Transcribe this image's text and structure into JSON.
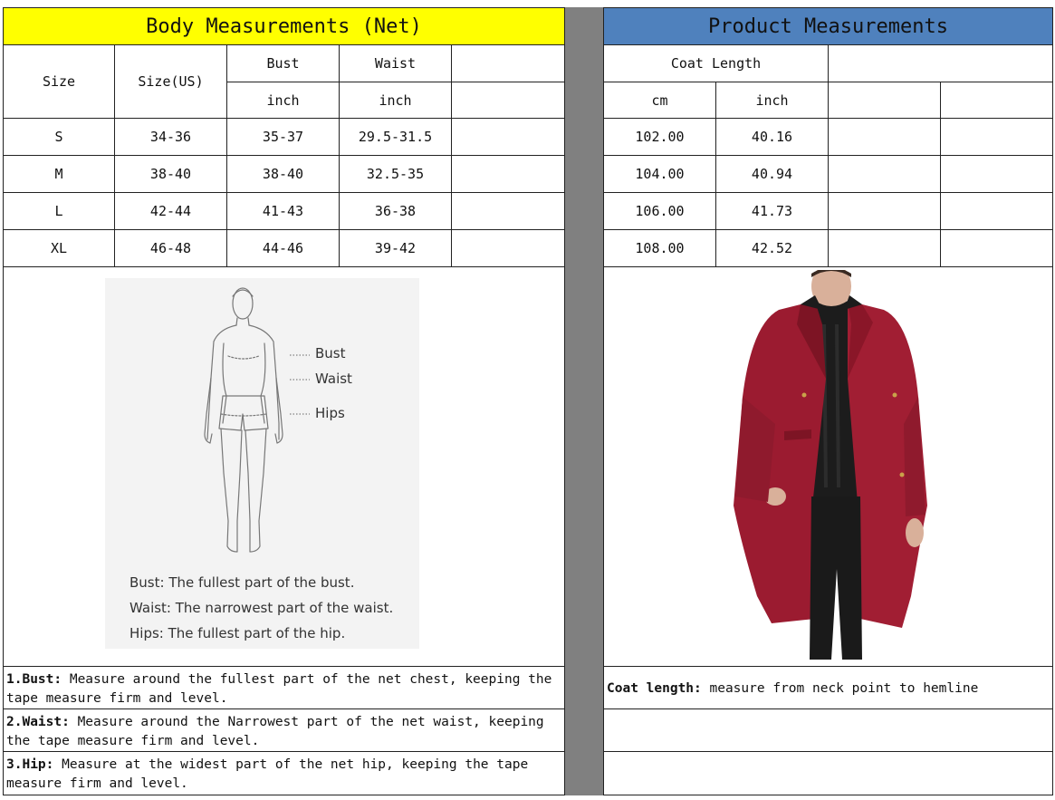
{
  "left_table": {
    "title": "Body Measurements  (Net)",
    "headers": {
      "size": "Size",
      "size_us": "Size(US)",
      "bust": "Bust",
      "waist": "Waist",
      "bust_unit": "inch",
      "waist_unit": "inch"
    },
    "rows": [
      {
        "size": "S",
        "size_us": "34-36",
        "bust": "35-37",
        "waist": "29.5-31.5"
      },
      {
        "size": "M",
        "size_us": "38-40",
        "bust": "38-40",
        "waist": "32.5-35"
      },
      {
        "size": "L",
        "size_us": "42-44",
        "bust": "41-43",
        "waist": "36-38"
      },
      {
        "size": "XL",
        "size_us": "46-48",
        "bust": "44-46",
        "waist": "39-42"
      }
    ]
  },
  "right_table": {
    "title": "Product Measurements",
    "headers": {
      "coat_length": "Coat Length",
      "cm": "cm",
      "inch": "inch"
    },
    "rows": [
      {
        "cm": "102.00",
        "inch": "40.16"
      },
      {
        "cm": "104.00",
        "inch": "40.94"
      },
      {
        "cm": "106.00",
        "inch": "41.73"
      },
      {
        "cm": "108.00",
        "inch": "42.52"
      }
    ]
  },
  "diagram": {
    "labels": {
      "bust": "Bust",
      "waist": "Waist",
      "hips": "Hips"
    },
    "legend": [
      {
        "term": "Bust:",
        "desc": "The fullest part of the bust."
      },
      {
        "term": "Waist:",
        "desc": "The narrowest part of the waist."
      },
      {
        "term": "Hips:",
        "desc": "The fullest part of the hip."
      }
    ]
  },
  "notes": [
    {
      "term": "1.Bust:",
      "text": "  Measure around the fullest part of the net chest, keeping the tape  measure firm and level."
    },
    {
      "term": "2.Waist:",
      "text": " Measure around the Narrowest part of the net waist, keeping the tape  measure firm and level."
    },
    {
      "term": "3.Hip:",
      "text": " Measure at the widest part of the net hip, keeping the tape measure firm and level."
    }
  ],
  "coat_note": {
    "term": "Coat length:",
    "text": " measure from neck point to hemline"
  },
  "colors": {
    "left_header": "#ffff00",
    "right_header": "#4f81bd",
    "divider": "#808080",
    "coat": "#9b1b30"
  }
}
